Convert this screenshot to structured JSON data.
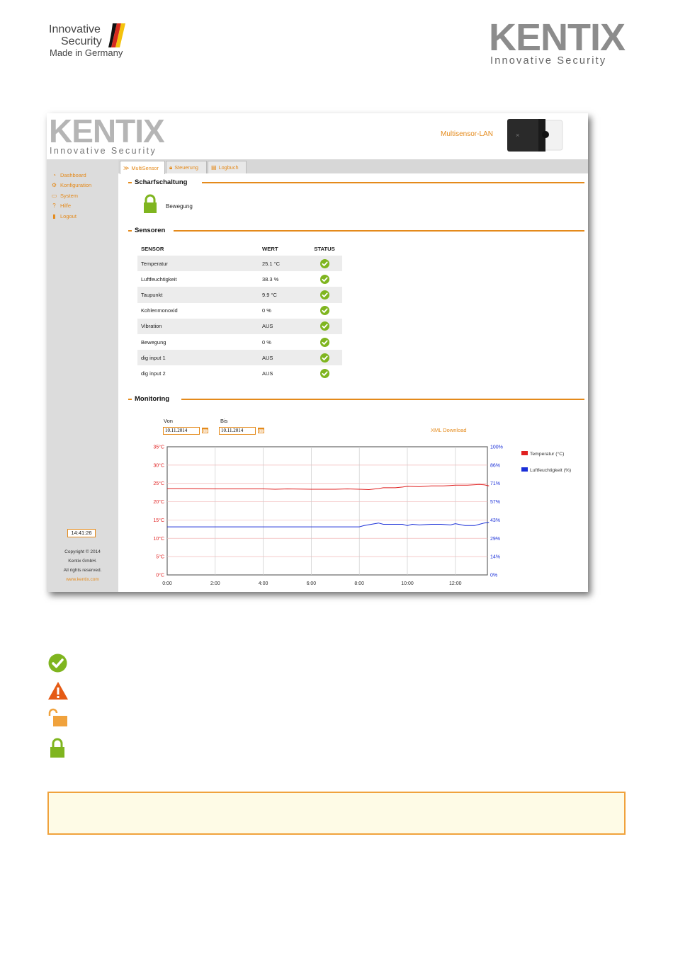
{
  "page_header": {
    "left_logo": {
      "line1": "Innovative",
      "line2": "Security",
      "line3": "Made in Germany"
    },
    "right_logo": {
      "word": "KENTIX",
      "tagline": "Innovative Security"
    }
  },
  "app": {
    "logo": {
      "word": "KENTIX",
      "tagline": "Innovative Security"
    },
    "product_title": "Multisensor-LAN",
    "sidebar": {
      "items": [
        {
          "label": "Dashboard",
          "icon": "dashboard-icon"
        },
        {
          "label": "Konfiguration",
          "icon": "gears-icon"
        },
        {
          "label": "System",
          "icon": "monitor-icon"
        },
        {
          "label": "Hilfe",
          "icon": "question-icon"
        },
        {
          "label": "Logout",
          "icon": "logout-icon"
        }
      ],
      "clock": "14:41:26",
      "copyright": [
        "Copyright © 2014",
        "Kentix GmbH.",
        "All rights reserved."
      ],
      "website": "www.kentix.com"
    },
    "tabs": [
      {
        "label": "MultiSensor",
        "icon": "sensor-icon",
        "active": true
      },
      {
        "label": "Steuerung",
        "icon": "lock-icon",
        "active": false
      },
      {
        "label": "Logbuch",
        "icon": "logbook-icon",
        "active": false
      }
    ],
    "sections": {
      "arming": "Scharfschaltung",
      "sensors": "Sensoren",
      "monitoring": "Monitoring"
    },
    "arming": {
      "label": "Bewegung",
      "state": "locked",
      "color": "#7fb51f"
    },
    "sensor_table": {
      "headers": [
        "SENSOR",
        "WERT",
        "STATUS"
      ],
      "rows": [
        {
          "sensor": "Temperatur",
          "value": "25.1 °C",
          "status": "ok"
        },
        {
          "sensor": "Luftfeuchtigkeit",
          "value": "38.3 %",
          "status": "ok"
        },
        {
          "sensor": "Taupunkt",
          "value": "9.9 °C",
          "status": "ok"
        },
        {
          "sensor": "Kohlenmonoxid",
          "value": "0 %",
          "status": "ok"
        },
        {
          "sensor": "Vibration",
          "value": "AUS",
          "status": "ok"
        },
        {
          "sensor": "Bewegung",
          "value": "0 %",
          "status": "ok"
        },
        {
          "sensor": "dig input 1",
          "value": "AUS",
          "status": "ok"
        },
        {
          "sensor": "dig input 2",
          "value": "AUS",
          "status": "ok"
        }
      ]
    },
    "monitoring": {
      "from_label": "Von",
      "from_value": "10.11.2014",
      "to_label": "Bis",
      "to_value": "10.11.2014",
      "xml_link": "XML Download"
    }
  },
  "chart_data": {
    "type": "line",
    "title": "",
    "x_ticks": [
      "0:00",
      "2:00",
      "4:00",
      "6:00",
      "8:00",
      "10:00",
      "12:00"
    ],
    "x_range_hours": [
      0,
      13.4
    ],
    "y_left": {
      "ticks": [
        "0°C",
        "5°C",
        "10°C",
        "15°C",
        "20°C",
        "25°C",
        "30°C",
        "35°C"
      ],
      "range": [
        0,
        35
      ],
      "color": "#e02020"
    },
    "y_right": {
      "ticks": [
        "0%",
        "14%",
        "29%",
        "43%",
        "57%",
        "71%",
        "86%",
        "100%"
      ],
      "range": [
        0,
        100
      ],
      "color": "#1a2fd8"
    },
    "grid": true,
    "legend": "right",
    "series": [
      {
        "name": "Temperatur (°C)",
        "axis": "left",
        "color": "#e02020",
        "x": [
          0,
          1,
          2,
          3,
          4,
          4.5,
          5,
          6,
          7,
          7.5,
          8,
          8.4,
          8.8,
          9,
          9.5,
          9.8,
          10,
          10.5,
          11,
          11.5,
          12,
          12.5,
          13,
          13.2,
          13.4
        ],
        "y": [
          23.6,
          23.6,
          23.5,
          23.5,
          23.5,
          23.4,
          23.5,
          23.4,
          23.4,
          23.5,
          23.4,
          23.3,
          23.6,
          23.8,
          23.8,
          24.0,
          24.2,
          24.1,
          24.3,
          24.3,
          24.5,
          24.5,
          24.7,
          24.6,
          24.3
        ]
      },
      {
        "name": "Luftfeuchtigkeit (%)",
        "axis": "right",
        "color": "#1a2fd8",
        "x": [
          0,
          1,
          2,
          3,
          4,
          5,
          6,
          7,
          8,
          8.2,
          8.5,
          8.8,
          9,
          9.4,
          9.8,
          10,
          10.2,
          10.5,
          11,
          11.4,
          11.8,
          12,
          12.4,
          12.8,
          13,
          13.2,
          13.4
        ],
        "y": [
          37.5,
          37.5,
          37.5,
          37.5,
          37.5,
          37.5,
          37.5,
          37.5,
          37.5,
          38.5,
          39.5,
          40.5,
          39.5,
          39.5,
          39.5,
          38.5,
          39.5,
          39.0,
          39.5,
          39.5,
          39.0,
          40.0,
          38.5,
          38.5,
          39.5,
          40.5,
          41.0
        ]
      }
    ]
  },
  "legend_icons": [
    "ok-check-icon",
    "warning-icon",
    "unlocked-icon",
    "locked-icon"
  ],
  "colors": {
    "accent": "#e48a1b",
    "ok": "#7fb51f",
    "warning": "#e55a14",
    "note_border": "#f0a23c",
    "note_bg": "#fefbe6"
  }
}
